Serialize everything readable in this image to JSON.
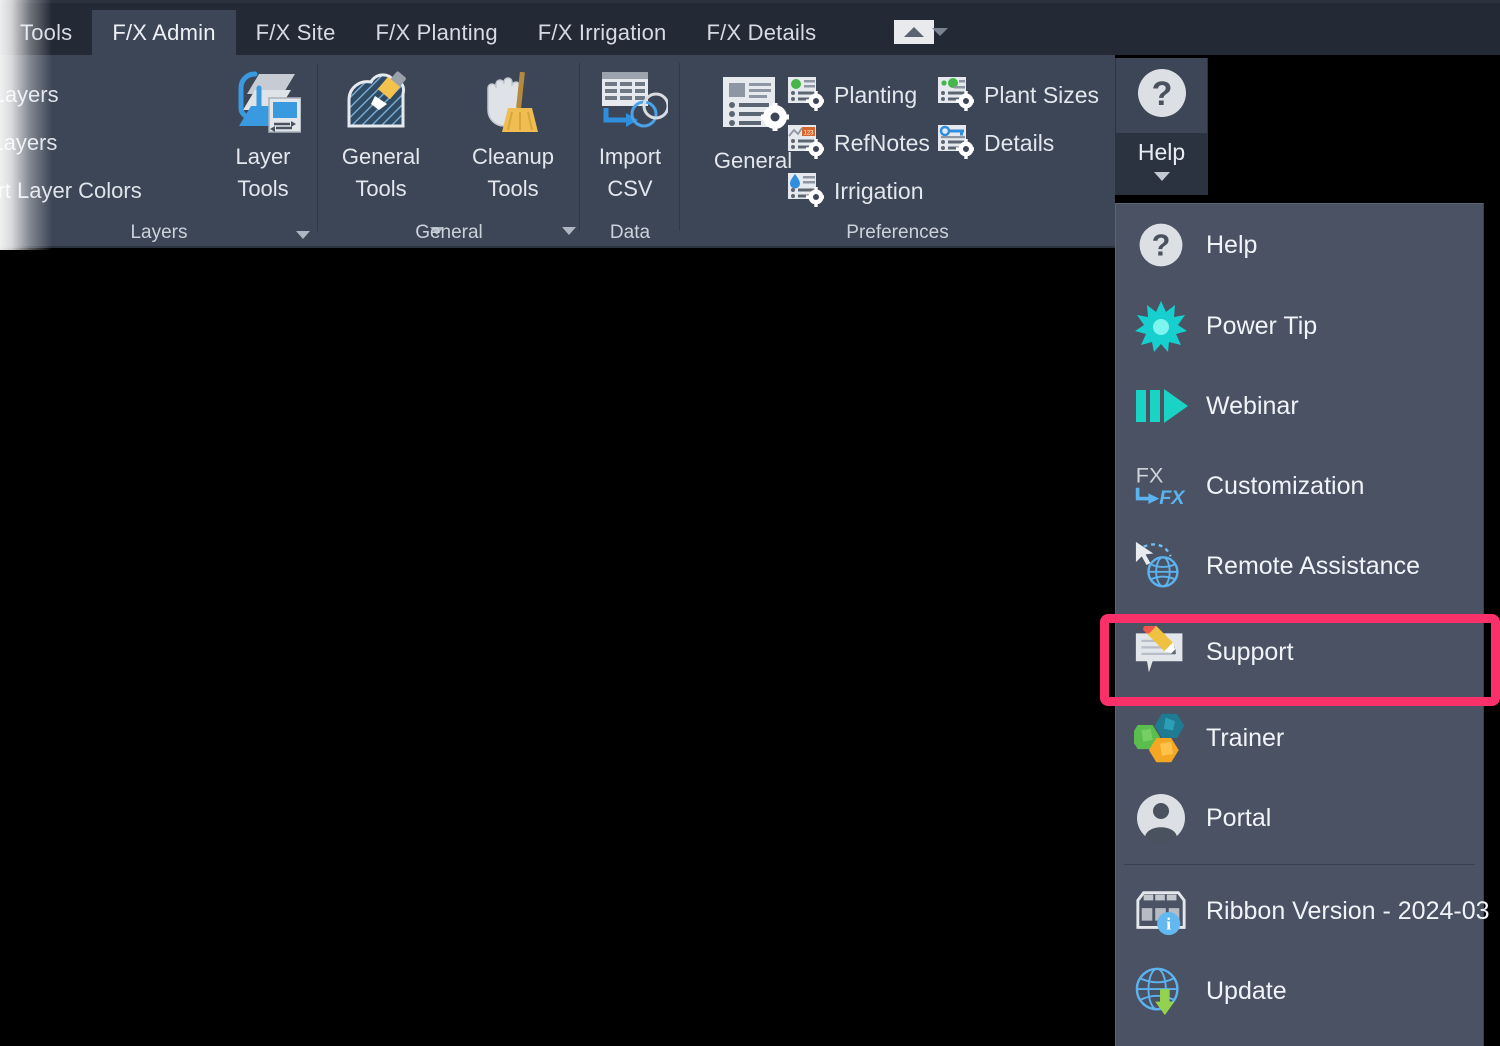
{
  "app": {
    "ribbon_bg": "#3d4656",
    "tabstrip_bg": "#232a35",
    "menu_bg": "#4a5263",
    "highlight_color": "#f9306a"
  },
  "tabs": [
    {
      "label": "Tools",
      "active": false
    },
    {
      "label": "F/X Admin",
      "active": true
    },
    {
      "label": "F/X Site",
      "active": false
    },
    {
      "label": "F/X Planting",
      "active": false
    },
    {
      "label": "F/X Irrigation",
      "active": false
    },
    {
      "label": "F/X Details",
      "active": false
    }
  ],
  "ribbon_controls": {
    "collapse_icon": "triangle-up-icon",
    "options_icon": "chevron-down-icon"
  },
  "panels": {
    "layers": {
      "title": "Layers",
      "list": [
        "ad Layers",
        "ve Layers",
        "nvert Layer Colors"
      ],
      "button": {
        "line1": "Layer",
        "line2": "Tools",
        "icon": "layer-tools-icon",
        "has_dropdown": true
      }
    },
    "general": {
      "title": "General",
      "buttons": [
        {
          "line1": "General",
          "line2": "Tools",
          "icon": "general-tools-icon",
          "has_dropdown": true
        },
        {
          "line1": "Cleanup",
          "line2": "Tools",
          "icon": "cleanup-tools-icon",
          "has_dropdown": true
        }
      ]
    },
    "data": {
      "title": "Data",
      "button": {
        "line1": "Import",
        "line2": "CSV",
        "icon": "import-csv-icon",
        "has_dropdown": false
      }
    },
    "preferences": {
      "title": "Preferences",
      "big_button": {
        "label": "General",
        "icon": "preferences-general-icon"
      },
      "small_buttons": [
        {
          "label": "Planting",
          "icon": "planting-prefs-icon"
        },
        {
          "label": "Plant Sizes",
          "icon": "plant-sizes-prefs-icon"
        },
        {
          "label": "RefNotes",
          "icon": "refnotes-prefs-icon"
        },
        {
          "label": "Details",
          "icon": "details-prefs-icon"
        },
        {
          "label": "Irrigation",
          "icon": "irrigation-prefs-icon"
        }
      ]
    }
  },
  "help_button": {
    "label": "Help",
    "icon": "question-mark-icon",
    "caret": "caret-down-icon"
  },
  "help_menu": {
    "items": [
      {
        "label": "Help",
        "icon": "question-mark-icon",
        "highlighted": false
      },
      {
        "label": "Power Tip",
        "icon": "starburst-icon",
        "highlighted": false
      },
      {
        "label": "Webinar",
        "icon": "play-bars-icon",
        "highlighted": false
      },
      {
        "label": "Customization",
        "icon": "fx-customization-icon",
        "highlighted": false
      },
      {
        "label": "Remote Assistance",
        "icon": "cursor-globe-icon",
        "highlighted": false
      },
      {
        "label": "Support",
        "icon": "speech-bubble-pencil-icon",
        "highlighted": true
      },
      {
        "label": "Trainer",
        "icon": "hexagons-icon",
        "highlighted": false
      },
      {
        "label": "Portal",
        "icon": "person-circle-icon",
        "highlighted": false
      }
    ],
    "footer_items": [
      {
        "label": "Ribbon Version - 2024-03",
        "icon": "ribbon-version-info-icon"
      },
      {
        "label": "Update",
        "icon": "globe-download-icon"
      }
    ]
  }
}
